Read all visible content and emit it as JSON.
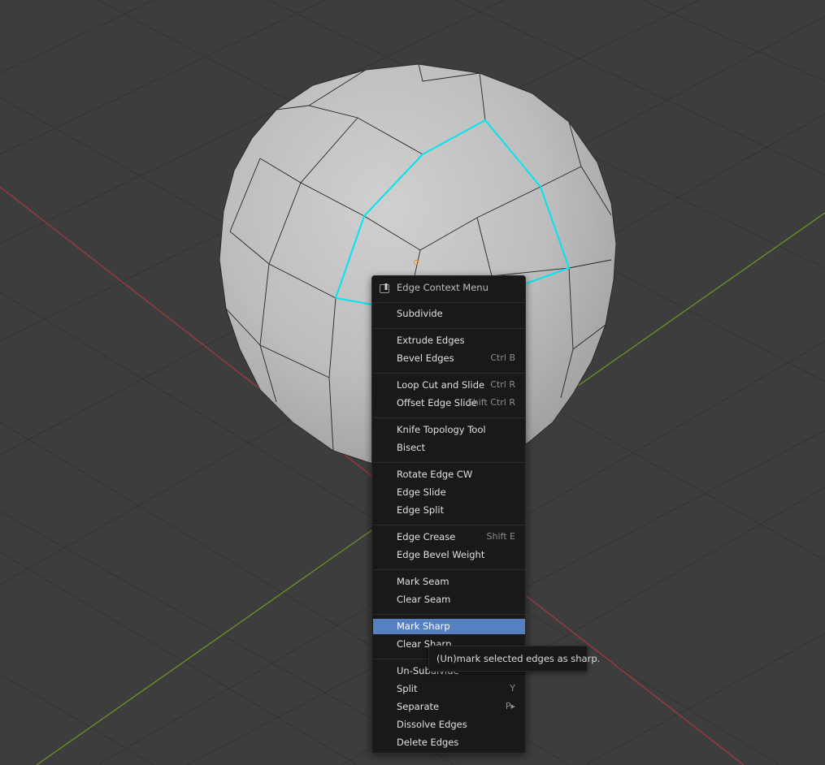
{
  "viewport": {
    "background": "#3d3d3d",
    "grid_color": "#353535",
    "x_axis_color": "#a8393f",
    "y_axis_color": "#6a9a2a",
    "selection_color": "#00e5f0"
  },
  "menu": {
    "title": "Edge Context Menu",
    "title_icon": "pin-icon",
    "items": [
      {
        "label": "Subdivide",
        "shortcut": ""
      },
      {
        "label": "Extrude Edges",
        "shortcut": ""
      },
      {
        "label": "Bevel Edges",
        "shortcut": "Ctrl B"
      },
      {
        "label": "Loop Cut and Slide",
        "shortcut": "Ctrl R"
      },
      {
        "label": "Offset Edge Slide",
        "shortcut": "Shift Ctrl R"
      },
      {
        "label": "Knife Topology Tool",
        "shortcut": ""
      },
      {
        "label": "Bisect",
        "shortcut": ""
      },
      {
        "label": "Rotate Edge CW",
        "shortcut": ""
      },
      {
        "label": "Edge Slide",
        "shortcut": ""
      },
      {
        "label": "Edge Split",
        "shortcut": ""
      },
      {
        "label": "Edge Crease",
        "shortcut": "Shift E"
      },
      {
        "label": "Edge Bevel Weight",
        "shortcut": ""
      },
      {
        "label": "Mark Seam",
        "shortcut": ""
      },
      {
        "label": "Clear Seam",
        "shortcut": ""
      },
      {
        "label": "Mark Sharp",
        "shortcut": ""
      },
      {
        "label": "Clear Sharp",
        "shortcut": ""
      },
      {
        "label": "Un-Subdivide",
        "shortcut": ""
      },
      {
        "label": "Split",
        "shortcut": "Y"
      },
      {
        "label": "Separate",
        "shortcut": "P▸"
      },
      {
        "label": "Dissolve Edges",
        "shortcut": ""
      },
      {
        "label": "Delete Edges",
        "shortcut": ""
      }
    ],
    "highlight_color": "#5680c2"
  },
  "tooltip": {
    "text": "(Un)mark selected edges as sharp."
  }
}
